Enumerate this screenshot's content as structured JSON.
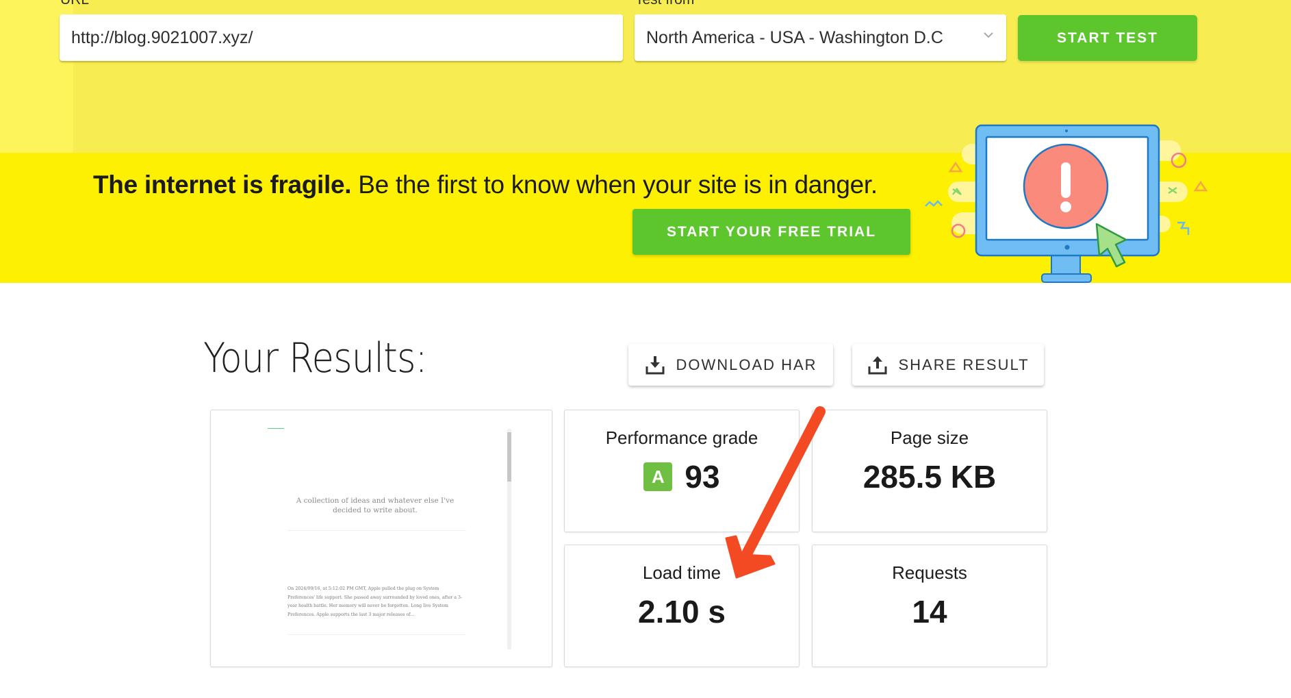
{
  "test_form": {
    "url_label": "URL",
    "url_value": "http://blog.9021007.xyz/",
    "location_label": "Test from",
    "location_selected": "North America - USA - Washington D.C",
    "start_test_label": "START TEST"
  },
  "banner": {
    "headline_bold": "The internet is fragile.",
    "headline_rest": " Be the first to know when your site is in danger.",
    "cta_label": "START YOUR FREE TRIAL",
    "illustration": "monitor-alert-illustration"
  },
  "results": {
    "title": "Your Results:",
    "download_har_label": "DOWNLOAD HAR",
    "share_result_label": "SHARE RESULT",
    "preview": {
      "tagline": "A collection of ideas and whatever else I've decided to write about.",
      "excerpt": "On 2024/09/16, at 5:12:02 PM GMT, Apple pulled the plug on System Preferences' life support. She passed away surrounded by loved ones, after a 3-year health battle. Her memory will never be forgotten. Long live System Preferences. Apple supports the last 3 major releases of..."
    },
    "metrics": {
      "performance_grade": {
        "label": "Performance grade",
        "grade": "A",
        "value": "93"
      },
      "page_size": {
        "label": "Page size",
        "value": "285.5 KB"
      },
      "load_time": {
        "label": "Load time",
        "value": "2.10 s"
      },
      "requests": {
        "label": "Requests",
        "value": "14"
      }
    }
  },
  "annotation": {
    "type": "arrow",
    "points_to": "load_time",
    "color": "#f44a24"
  },
  "colors": {
    "top_bg": "#f7ed52",
    "banner_bg": "#fdf000",
    "button_green": "#5dc62d",
    "grade_green": "#6fbf42"
  }
}
